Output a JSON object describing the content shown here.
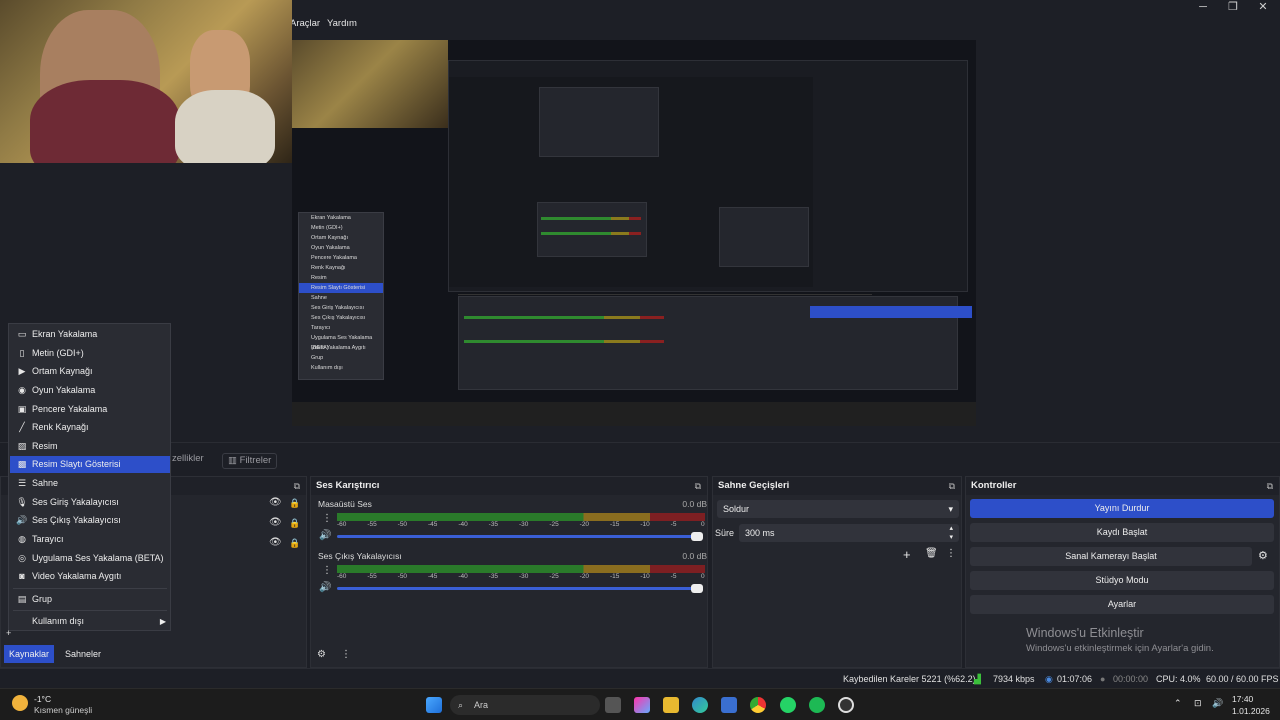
{
  "menubar": {
    "items": [
      "Araçlar",
      "Yardım"
    ]
  },
  "window_controls": {
    "minimize": "─",
    "maximize": "❐",
    "close": "✕"
  },
  "dock_tabs": {
    "properties_ghost": "zellikler",
    "filters": "Filtreler"
  },
  "context_menu": {
    "items": [
      {
        "label": "Ekran Yakalama",
        "icon": "monitor-icon"
      },
      {
        "label": "Metin (GDI+)",
        "icon": "text-icon"
      },
      {
        "label": "Ortam Kaynağı",
        "icon": "play-icon"
      },
      {
        "label": "Oyun Yakalama",
        "icon": "gamepad-icon"
      },
      {
        "label": "Pencere Yakalama",
        "icon": "window-icon"
      },
      {
        "label": "Renk Kaynağı",
        "icon": "brush-icon"
      },
      {
        "label": "Resim",
        "icon": "image-icon"
      },
      {
        "label": "Resim Slaytı Gösterisi",
        "icon": "slideshow-icon",
        "highlighted": true
      },
      {
        "label": "Sahne",
        "icon": "list-icon"
      },
      {
        "label": "Ses Giriş Yakalayıcısı",
        "icon": "microphone-icon"
      },
      {
        "label": "Ses Çıkış Yakalayıcısı",
        "icon": "speaker-icon"
      },
      {
        "label": "Tarayıcı",
        "icon": "globe-icon"
      },
      {
        "label": "Uygulama Ses Yakalama (BETA)",
        "icon": "app-audio-icon"
      },
      {
        "label": "Video Yakalama Aygıtı",
        "icon": "camera-icon"
      },
      {
        "label": "Grup",
        "icon": "folder-icon"
      },
      {
        "label": "Kullanım dışı",
        "icon": "submenu-arrow-icon"
      }
    ]
  },
  "bottom_tabs": {
    "sources": "Kaynaklar",
    "scenes": "Sahneler"
  },
  "mixer": {
    "title": "Ses Karıştırıcı",
    "channels": [
      {
        "name": "Masaüstü Ses",
        "db": "0.0 dB"
      },
      {
        "name": "Ses Çıkış Yakalayıcısı",
        "db": "0.0 dB"
      }
    ],
    "ticks": [
      "-60",
      "-55",
      "-50",
      "-45",
      "-40",
      "-35",
      "-30",
      "-25",
      "-20",
      "-15",
      "-10",
      "-5",
      "0"
    ]
  },
  "transitions": {
    "title": "Sahne Geçişleri",
    "type": "Soldur",
    "duration_label": "Süre",
    "duration": "300 ms"
  },
  "controls": {
    "title": "Kontroller",
    "stop_stream": "Yayını Durdur",
    "start_record": "Kaydı Başlat",
    "virtual_cam": "Sanal Kamerayı Başlat",
    "studio_mode": "Stüdyo Modu",
    "settings": "Ayarlar"
  },
  "activation": {
    "title": "Windows'u Etkinleştir",
    "subtitle": "Windows'u etkinleştirmek için Ayarlar'a gidin."
  },
  "status": {
    "dropped": "Kaybedilen Kareler 5221 (%62.2)",
    "bitrate": "7934 kbps",
    "stream_time": "01:07:06",
    "record_time": "00:00:00",
    "cpu": "CPU: 4.0%",
    "fps": "60.00 / 60.00 FPS"
  },
  "taskbar": {
    "weather_temp": "-1°C",
    "weather_desc": "Kısmen güneşli",
    "search": "Ara",
    "time": "17:40",
    "date": "1.01.2026"
  },
  "nested_preview": {
    "menu_items": [
      "Ekran Yakalama",
      "Metin (GDI+)",
      "Ortam Kaynağı",
      "Oyun Yakalama",
      "Pencere Yakalama",
      "Renk Kaynağı",
      "Resim",
      "Resim Slaytı Gösterisi",
      "Sahne",
      "Ses Giriş Yakalayıcısı",
      "Ses Çıkış Yakalayıcısı",
      "Tarayıcı",
      "Uygulama Ses Yakalama (BETA)",
      "Video Yakalama Aygıtı",
      "Grup",
      "Kullanım dışı"
    ]
  }
}
